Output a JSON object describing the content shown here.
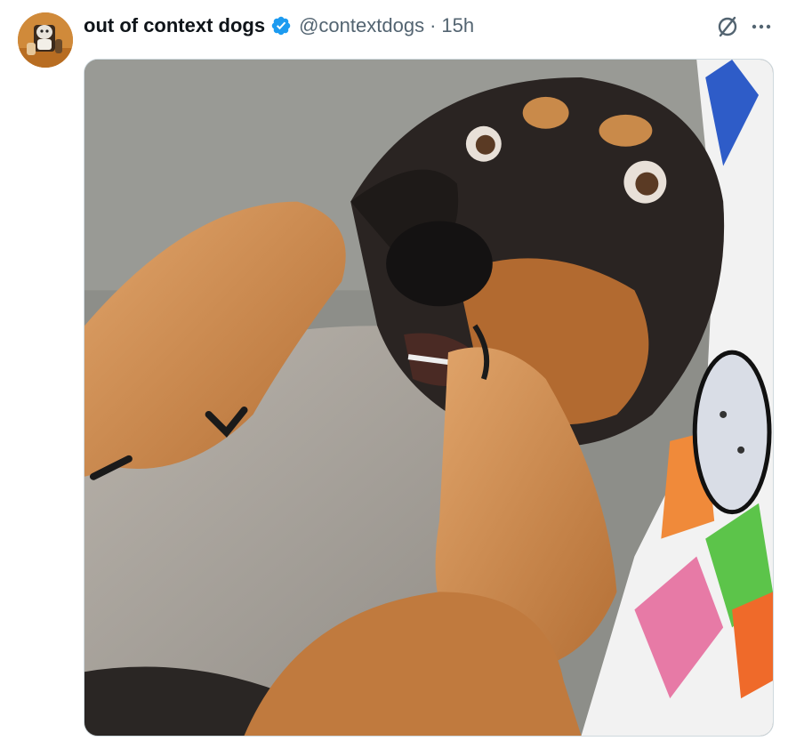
{
  "author": {
    "display_name": "out of context dogs",
    "handle": "@contextdogs",
    "separator": "·",
    "time": "15h",
    "verified": true
  },
  "icons": {
    "avatar": "dog-avatar",
    "verified": "verified-badge-icon",
    "grok": "grok-icon",
    "more": "more-icon"
  },
  "media": {
    "alt": "Dachshund lying on its back biting its own paw"
  },
  "colors": {
    "verified_blue": "#1d9bf0",
    "text_primary": "#0f1419",
    "text_secondary": "#536471"
  }
}
